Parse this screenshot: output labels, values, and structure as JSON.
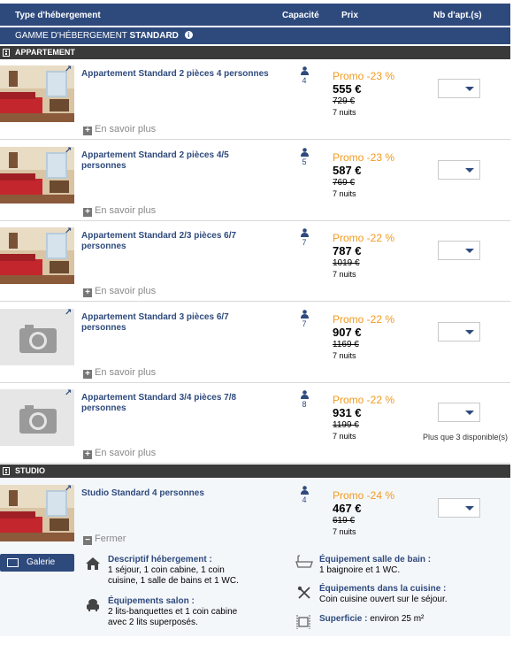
{
  "table_header": {
    "type": "Type d'hébergement",
    "capacity": "Capacité",
    "price": "Prix",
    "count": "Nb d'apt.(s)"
  },
  "range": {
    "label": "GAMME D'HÉBERGEMENT",
    "name": "STANDARD",
    "info_icon": "info-icon"
  },
  "categories": {
    "apartment": "APPARTEMENT",
    "studio": "STUDIO"
  },
  "more_label": "En savoir plus",
  "close_label": "Fermer",
  "rows": [
    {
      "title": "Appartement Standard 2 pièces 4 personnes",
      "capacity": "4",
      "promo": "Promo -23 %",
      "price": "555 €",
      "old_price": "729 €",
      "nights": "7 nuits",
      "photo": true
    },
    {
      "title": "Appartement Standard 2 pièces 4/5 personnes",
      "capacity": "5",
      "promo": "Promo -23 %",
      "price": "587 €",
      "old_price": "769 €",
      "nights": "7 nuits",
      "photo": true
    },
    {
      "title": "Appartement Standard 2/3 pièces 6/7 personnes",
      "capacity": "7",
      "promo": "Promo -22 %",
      "price": "787 €",
      "old_price": "1019 €",
      "nights": "7 nuits",
      "photo": true
    },
    {
      "title": "Appartement Standard 3 pièces 6/7 personnes",
      "capacity": "7",
      "promo": "Promo -22 %",
      "price": "907 €",
      "old_price": "1169 €",
      "nights": "7 nuits",
      "photo": false
    },
    {
      "title": "Appartement Standard 3/4 pièces 7/8 personnes",
      "capacity": "8",
      "promo": "Promo -22 %",
      "price": "931 €",
      "old_price": "1199 €",
      "nights": "7 nuits",
      "photo": false,
      "availability": "Plus que 3 disponible(s)"
    }
  ],
  "studio": {
    "title": "Studio Standard 4 personnes",
    "capacity": "4",
    "promo": "Promo -24 %",
    "price": "467 €",
    "old_price": "619 €",
    "nights": "7 nuits",
    "gallery_label": "Galerie",
    "details": {
      "desc_title": "Descriptif hébergement :",
      "desc_line1": "1 séjour, 1 coin cabine, 1 coin",
      "desc_line2": "cuisine, 1 salle de bains et 1 WC.",
      "salon_title": "Équipements salon :",
      "salon_line1": "2 lits-banquettes et 1 coin cabine",
      "salon_line2": "avec 2 lits superposés.",
      "bath_title": "Équipement salle de bain :",
      "bath_text": "1 baignoire et 1 WC.",
      "kitchen_title": "Équipements dans la cuisine :",
      "kitchen_text": "Coin cuisine ouvert sur le séjour.",
      "area_title": "Superficie :",
      "area_text": "environ 25 m²"
    }
  },
  "colors": {
    "header": "#2e4a7d",
    "promo": "#f29a1e",
    "category_bar": "#3a3a3a"
  }
}
